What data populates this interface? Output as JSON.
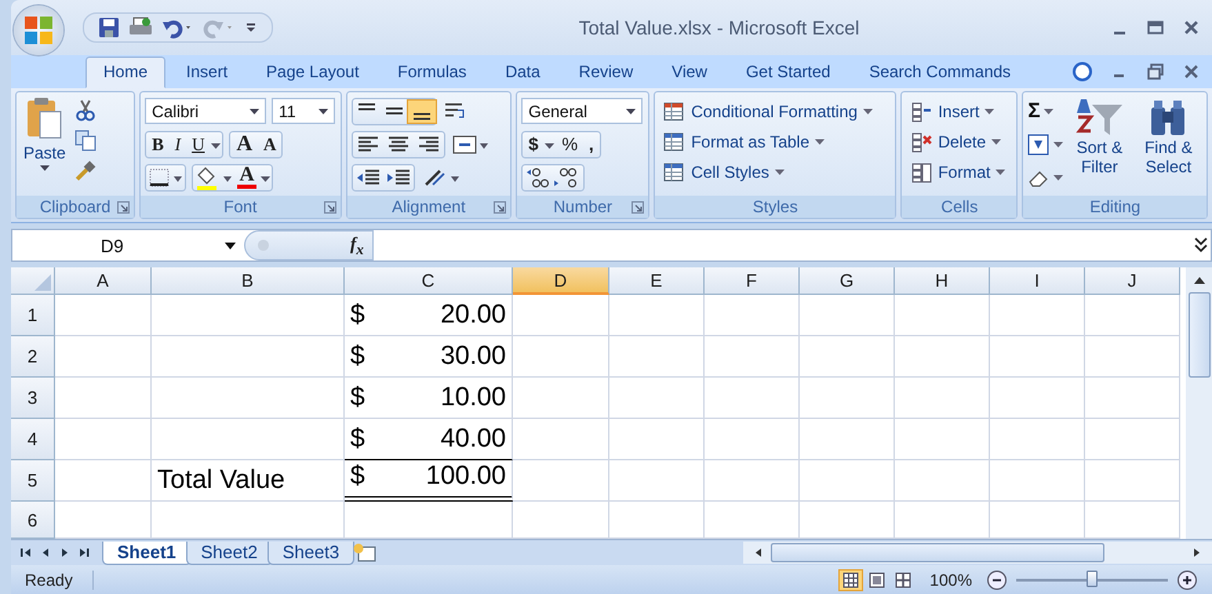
{
  "window": {
    "title": "Total Value.xlsx - Microsoft Excel"
  },
  "ribbon_tabs": [
    {
      "label": "Home",
      "selected": true
    },
    {
      "label": "Insert",
      "selected": false
    },
    {
      "label": "Page Layout",
      "selected": false
    },
    {
      "label": "Formulas",
      "selected": false
    },
    {
      "label": "Data",
      "selected": false
    },
    {
      "label": "Review",
      "selected": false
    },
    {
      "label": "View",
      "selected": false
    },
    {
      "label": "Get Started",
      "selected": false
    },
    {
      "label": "Search Commands",
      "selected": false
    }
  ],
  "clipboard": {
    "paste": "Paste",
    "group": "Clipboard"
  },
  "font": {
    "name": "Calibri",
    "size": "11",
    "bold": "B",
    "italic": "I",
    "underline": "U",
    "grow": "A",
    "shrink": "A",
    "color_letter": "A",
    "group": "Font"
  },
  "alignment": {
    "vertical": [
      {
        "selected": false
      },
      {
        "selected": false
      },
      {
        "selected": true
      }
    ],
    "group": "Alignment"
  },
  "number": {
    "format": "General",
    "currency": "$",
    "percent": "%",
    "comma": ",",
    "group": "Number"
  },
  "styles": {
    "items": [
      "Conditional Formatting",
      "Format as Table",
      "Cell Styles"
    ],
    "group": "Styles"
  },
  "cells": {
    "items": [
      "Insert",
      "Delete",
      "Format"
    ],
    "group": "Cells"
  },
  "editing": {
    "sum": "Σ",
    "sort": "Sort & Filter",
    "find": "Find & Select",
    "group": "Editing"
  },
  "formula_bar": {
    "name_box": "D9",
    "fx": "f$_{x}$"
  },
  "sheet": {
    "columns": [
      {
        "label": "A",
        "selected": false
      },
      {
        "label": "B",
        "selected": false
      },
      {
        "label": "C",
        "selected": false
      },
      {
        "label": "D",
        "selected": true
      },
      {
        "label": "E",
        "selected": false
      },
      {
        "label": "F",
        "selected": false
      },
      {
        "label": "G",
        "selected": false
      },
      {
        "label": "H",
        "selected": false
      },
      {
        "label": "I",
        "selected": false
      },
      {
        "label": "J",
        "selected": false
      }
    ],
    "rows": [
      {
        "label": "1",
        "c": {
          "symbol": "$",
          "amount": "20.00",
          "kind": "plain"
        }
      },
      {
        "label": "2",
        "c": {
          "symbol": "$",
          "amount": "30.00",
          "kind": "plain"
        }
      },
      {
        "label": "3",
        "c": {
          "symbol": "$",
          "amount": "10.00",
          "kind": "plain"
        }
      },
      {
        "label": "4",
        "c": {
          "symbol": "$",
          "amount": "40.00",
          "kind": "underlined"
        }
      },
      {
        "label": "5",
        "b": "Total Value",
        "c": {
          "symbol": "$",
          "amount": "100.00",
          "kind": "double_underlined"
        }
      },
      {
        "label": "6"
      }
    ]
  },
  "sheet_tabs": [
    {
      "label": "Sheet1",
      "selected": true
    },
    {
      "label": "Sheet2",
      "selected": false
    },
    {
      "label": "Sheet3",
      "selected": false
    }
  ],
  "status_bar": {
    "status": "Ready",
    "views": [
      {
        "selected": true
      },
      {
        "selected": false
      },
      {
        "selected": false
      }
    ],
    "zoom": "100%",
    "zoom_slider": {
      "level": 0.5
    }
  }
}
